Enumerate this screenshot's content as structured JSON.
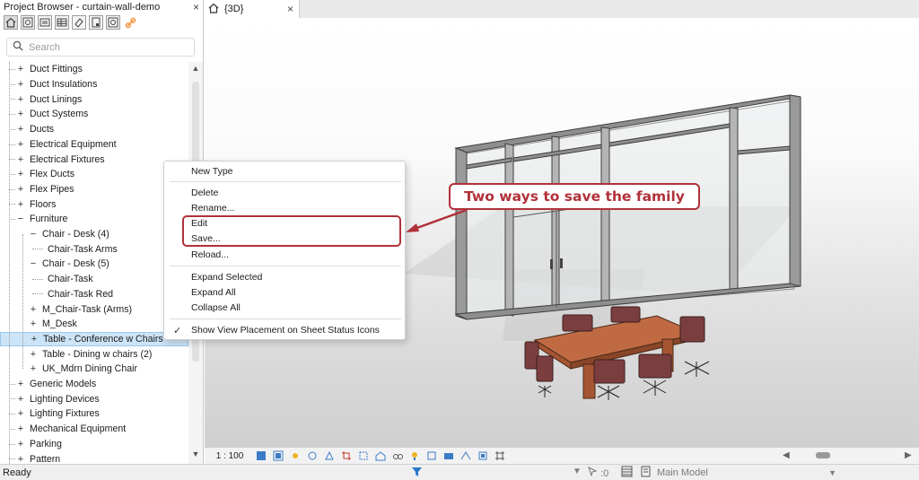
{
  "browser": {
    "title": "Project Browser - curtain-wall-demo",
    "close_glyph": "×",
    "search_placeholder": "Search",
    "toolbar_icons": [
      "home-icon",
      "zoom-fit-icon",
      "sheet-icon",
      "table-icon",
      "eraser-icon",
      "sheet-list-icon",
      "nested-view-icon",
      "link-icon"
    ],
    "tree": [
      {
        "label": "Duct Fittings",
        "level": 0,
        "state": "collapsed"
      },
      {
        "label": "Duct Insulations",
        "level": 0,
        "state": "collapsed"
      },
      {
        "label": "Duct Linings",
        "level": 0,
        "state": "collapsed"
      },
      {
        "label": "Duct Systems",
        "level": 0,
        "state": "collapsed"
      },
      {
        "label": "Ducts",
        "level": 0,
        "state": "collapsed"
      },
      {
        "label": "Electrical Equipment",
        "level": 0,
        "state": "collapsed"
      },
      {
        "label": "Electrical Fixtures",
        "level": 0,
        "state": "collapsed"
      },
      {
        "label": "Flex Ducts",
        "level": 0,
        "state": "collapsed"
      },
      {
        "label": "Flex Pipes",
        "level": 0,
        "state": "collapsed"
      },
      {
        "label": "Floors",
        "level": 0,
        "state": "collapsed"
      },
      {
        "label": "Furniture",
        "level": 0,
        "state": "expanded"
      },
      {
        "label": "Chair - Desk (4)",
        "level": 1,
        "state": "expanded"
      },
      {
        "label": "Chair-Task Arms",
        "level": 2,
        "state": "leaf"
      },
      {
        "label": "Chair - Desk (5)",
        "level": 1,
        "state": "expanded"
      },
      {
        "label": "Chair-Task",
        "level": 2,
        "state": "leaf"
      },
      {
        "label": "Chair-Task Red",
        "level": 2,
        "state": "leaf"
      },
      {
        "label": "M_Chair-Task (Arms)",
        "level": 1,
        "state": "collapsed"
      },
      {
        "label": "M_Desk",
        "level": 1,
        "state": "collapsed"
      },
      {
        "label": "Table - Conference w Chairs",
        "level": 1,
        "state": "collapsed",
        "selected": true
      },
      {
        "label": "Table - Dining w chairs (2)",
        "level": 1,
        "state": "collapsed"
      },
      {
        "label": "UK_Mdrn Dining Chair",
        "level": 1,
        "state": "collapsed"
      },
      {
        "label": "Generic Models",
        "level": 0,
        "state": "collapsed"
      },
      {
        "label": "Lighting Devices",
        "level": 0,
        "state": "collapsed"
      },
      {
        "label": "Lighting Fixtures",
        "level": 0,
        "state": "collapsed"
      },
      {
        "label": "Mechanical Equipment",
        "level": 0,
        "state": "collapsed"
      },
      {
        "label": "Parking",
        "level": 0,
        "state": "collapsed"
      },
      {
        "label": "Pattern",
        "level": 0,
        "state": "collapsed"
      }
    ]
  },
  "view_tab": {
    "label": "{3D}",
    "close_glyph": "×"
  },
  "context_menu": {
    "items": [
      "New Type",
      "Delete",
      "Rename...",
      "Edit",
      "Save...",
      "Reload...",
      "Expand Selected",
      "Expand All",
      "Collapse All",
      "Show View Placement on Sheet Status Icons"
    ],
    "checked_item": "Show View Placement on Sheet Status Icons",
    "check_glyph": "✓"
  },
  "annotation": {
    "callout_text": "Two ways to save the family",
    "accent_color": "#b1313a"
  },
  "view_bar": {
    "scale": "1 : 100",
    "icons": [
      "model-graphics-icon",
      "visual-style-icon",
      "sun-path-icon",
      "shadows-icon",
      "render-icon",
      "crop-view-icon",
      "show-crop-icon",
      "unlock-3d-icon",
      "temporary-hide-icon",
      "reveal-hidden-icon",
      "temp-view-properties-icon",
      "worksharing-display-icon",
      "highlight-displacement-icon",
      "reveal-constraints-icon",
      "analytical-model-icon"
    ]
  },
  "status_bar": {
    "text": "Ready",
    "counter": ":0",
    "model_select": "Main Model"
  }
}
